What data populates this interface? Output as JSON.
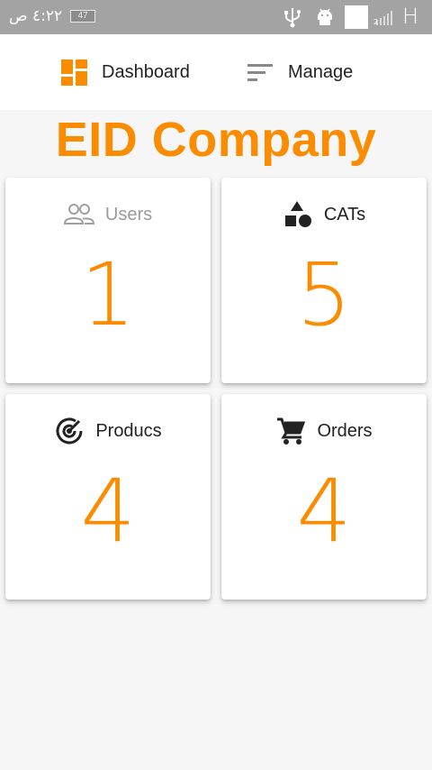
{
  "status_bar": {
    "time": "٤:٢٢ ص",
    "battery": "47",
    "network": "H"
  },
  "nav": {
    "dashboard_label": "Dashboard",
    "manage_label": "Manage",
    "dashboard_icon": "dashboard-icon",
    "manage_icon": "sort-icon"
  },
  "title": "EID Company",
  "colors": {
    "accent": "#fb8c00",
    "status_bar": "#a3a3a3",
    "background": "#f6f6f6"
  },
  "cards": [
    {
      "label": "Users",
      "value": "1",
      "icon": "users-icon"
    },
    {
      "label": "CATs",
      "value": "5",
      "icon": "shapes-icon"
    },
    {
      "label": "Producs",
      "value": "4",
      "icon": "radar-icon"
    },
    {
      "label": "Orders",
      "value": "4",
      "icon": "cart-icon"
    }
  ]
}
